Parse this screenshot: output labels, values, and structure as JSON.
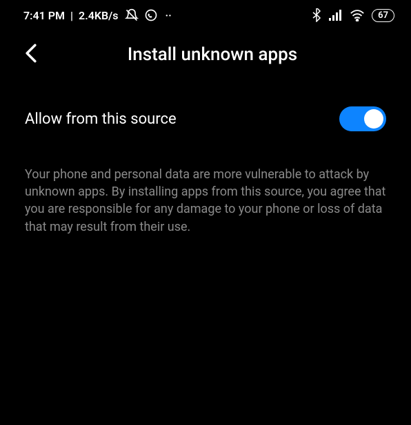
{
  "statusBar": {
    "time": "7:41 PM",
    "separator": "|",
    "dataRate": "2.4KB/s",
    "battery": "67"
  },
  "header": {
    "title": "Install unknown apps"
  },
  "setting": {
    "label": "Allow from this source",
    "enabled": true
  },
  "description": {
    "text": "Your phone and personal data are more vulnerable to attack by unknown apps. By installing apps from this source, you agree that you are responsible for any damage to your phone or loss of data that may result from their use."
  }
}
